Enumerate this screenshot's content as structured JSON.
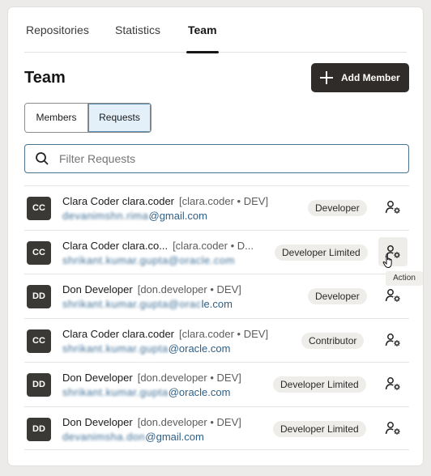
{
  "tabs": [
    {
      "label": "Repositories"
    },
    {
      "label": "Statistics"
    },
    {
      "label": "Team"
    }
  ],
  "page": {
    "title": "Team"
  },
  "toolbar": {
    "add_label": "Add Member"
  },
  "segmented": {
    "members": "Members",
    "requests": "Requests",
    "selected": "Requests"
  },
  "search": {
    "placeholder": "Filter Requests",
    "value": ""
  },
  "rows": [
    {
      "initials": "CC",
      "name": "Clara Coder clara.coder",
      "meta": "[clara.coder • DEV]",
      "email_local": "devanimshn.rima",
      "email_domain": "@gmail.com",
      "role": "Developer"
    },
    {
      "initials": "CC",
      "name": "Clara Coder clara.co...",
      "meta": "[clara.coder • D...",
      "email_local": "shrikant.kumar.gupta@oracle.com",
      "email_domain": "",
      "role": "Developer Limited"
    },
    {
      "initials": "DD",
      "name": "Don Developer",
      "meta": "[don.developer • DEV]",
      "email_local": "shrikant.kumar.gupta@orac",
      "email_domain": "le.com",
      "role": "Developer"
    },
    {
      "initials": "CC",
      "name": "Clara Coder clara.coder",
      "meta": "[clara.coder • DEV]",
      "email_local": "shrikant.kumar.gupta",
      "email_domain": "@oracle.com",
      "role": "Contributor"
    },
    {
      "initials": "DD",
      "name": "Don Developer",
      "meta": "[don.developer • DEV]",
      "email_local": "shrikant.kumar.gupta",
      "email_domain": "@oracle.com",
      "role": "Developer Limited"
    },
    {
      "initials": "DD",
      "name": "Don Developer",
      "meta": "[don.developer • DEV]",
      "email_local": "devanimsha.don",
      "email_domain": "@gmail.com",
      "role": "Developer Limited"
    }
  ],
  "tooltip": {
    "text": "Action"
  },
  "icons": {
    "add": "plus-icon",
    "search": "search-icon",
    "action": "user-gear-icon"
  }
}
